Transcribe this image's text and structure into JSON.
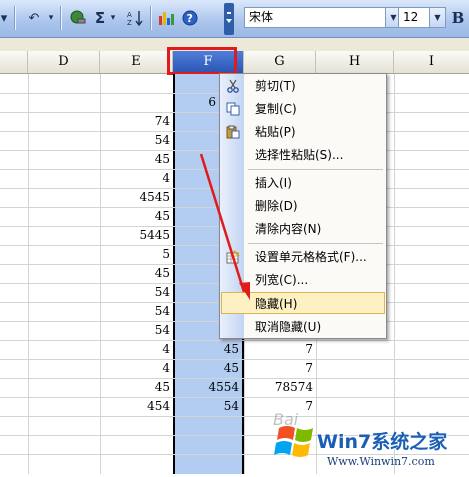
{
  "toolbar": {
    "font_name": "宋体",
    "font_size": "12",
    "sum_symbol": "Σ"
  },
  "columns": [
    "D",
    "E",
    "F",
    "G",
    "H",
    "I"
  ],
  "cells": {
    "E": [
      "74",
      "54",
      "45",
      "4",
      "4545",
      "45",
      "5445",
      "5",
      "45",
      "54",
      "54",
      "54",
      "4",
      "4",
      "45",
      "454"
    ],
    "F": [
      "6",
      "45",
      "45",
      "4554",
      "54"
    ],
    "G": [
      "7",
      "7",
      "78574",
      "7"
    ]
  },
  "context_menu": {
    "items": [
      {
        "label": "剪切(T)",
        "icon": "scissors-icon"
      },
      {
        "label": "复制(C)",
        "icon": "copy-icon"
      },
      {
        "label": "粘贴(P)",
        "icon": "paste-icon"
      },
      {
        "label": "选择性粘贴(S)...",
        "icon": ""
      },
      {
        "label": "插入(I)",
        "icon": ""
      },
      {
        "label": "删除(D)",
        "icon": ""
      },
      {
        "label": "清除内容(N)",
        "icon": ""
      },
      {
        "label": "设置单元格格式(F)...",
        "icon": "format-cells-icon"
      },
      {
        "label": "列宽(C)...",
        "icon": ""
      },
      {
        "label": "隐藏(H)",
        "icon": ""
      },
      {
        "label": "取消隐藏(U)",
        "icon": ""
      }
    ],
    "highlighted_index": 9
  },
  "annotation": {
    "color": "#e11b1b"
  },
  "watermark": {
    "brand": "Win7系统之家",
    "url": "Www.Winwin7.com",
    "faint_text": "Bai"
  },
  "colors": {
    "selection": "#b3cdf2",
    "header_selected": "#2b55b3",
    "menu_highlight": "#fdf1c4"
  }
}
